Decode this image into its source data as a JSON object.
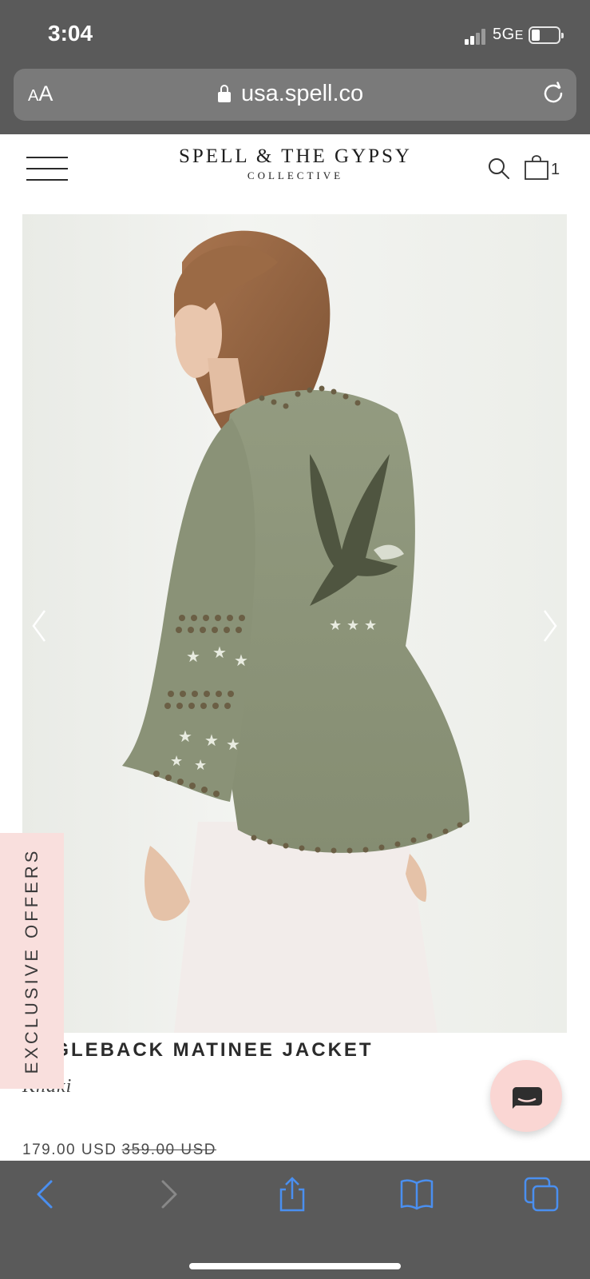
{
  "status_bar": {
    "time": "3:04",
    "network": "5G",
    "network_suffix": "E"
  },
  "browser": {
    "text_size_small": "A",
    "text_size_big": "A",
    "url": "usa.spell.co",
    "icons": [
      "lock-icon",
      "reload-icon",
      "back-icon",
      "forward-icon",
      "share-icon",
      "bookmarks-icon",
      "tabs-icon"
    ]
  },
  "header": {
    "logo_main": "SPELL & THE GYPSY",
    "logo_sub": "COLLECTIVE",
    "cart_count": "1",
    "icons": [
      "menu-icon",
      "search-icon",
      "shopping-bag-icon"
    ]
  },
  "product": {
    "title": "EAGLEBACK MATINEE JACKET",
    "color": "Khaki",
    "price": "179.00 USD",
    "original_price": "359.00 USD"
  },
  "offers_tab": {
    "label": "EXCLUSIVE OFFERS"
  },
  "colors": {
    "chrome": "#5a5a5a",
    "url_field": "#7a7a7a",
    "toolbar_icon": "#4a8ff0",
    "offers_tab": "#f9dfdd",
    "jacket_khaki": "#8e9679"
  }
}
